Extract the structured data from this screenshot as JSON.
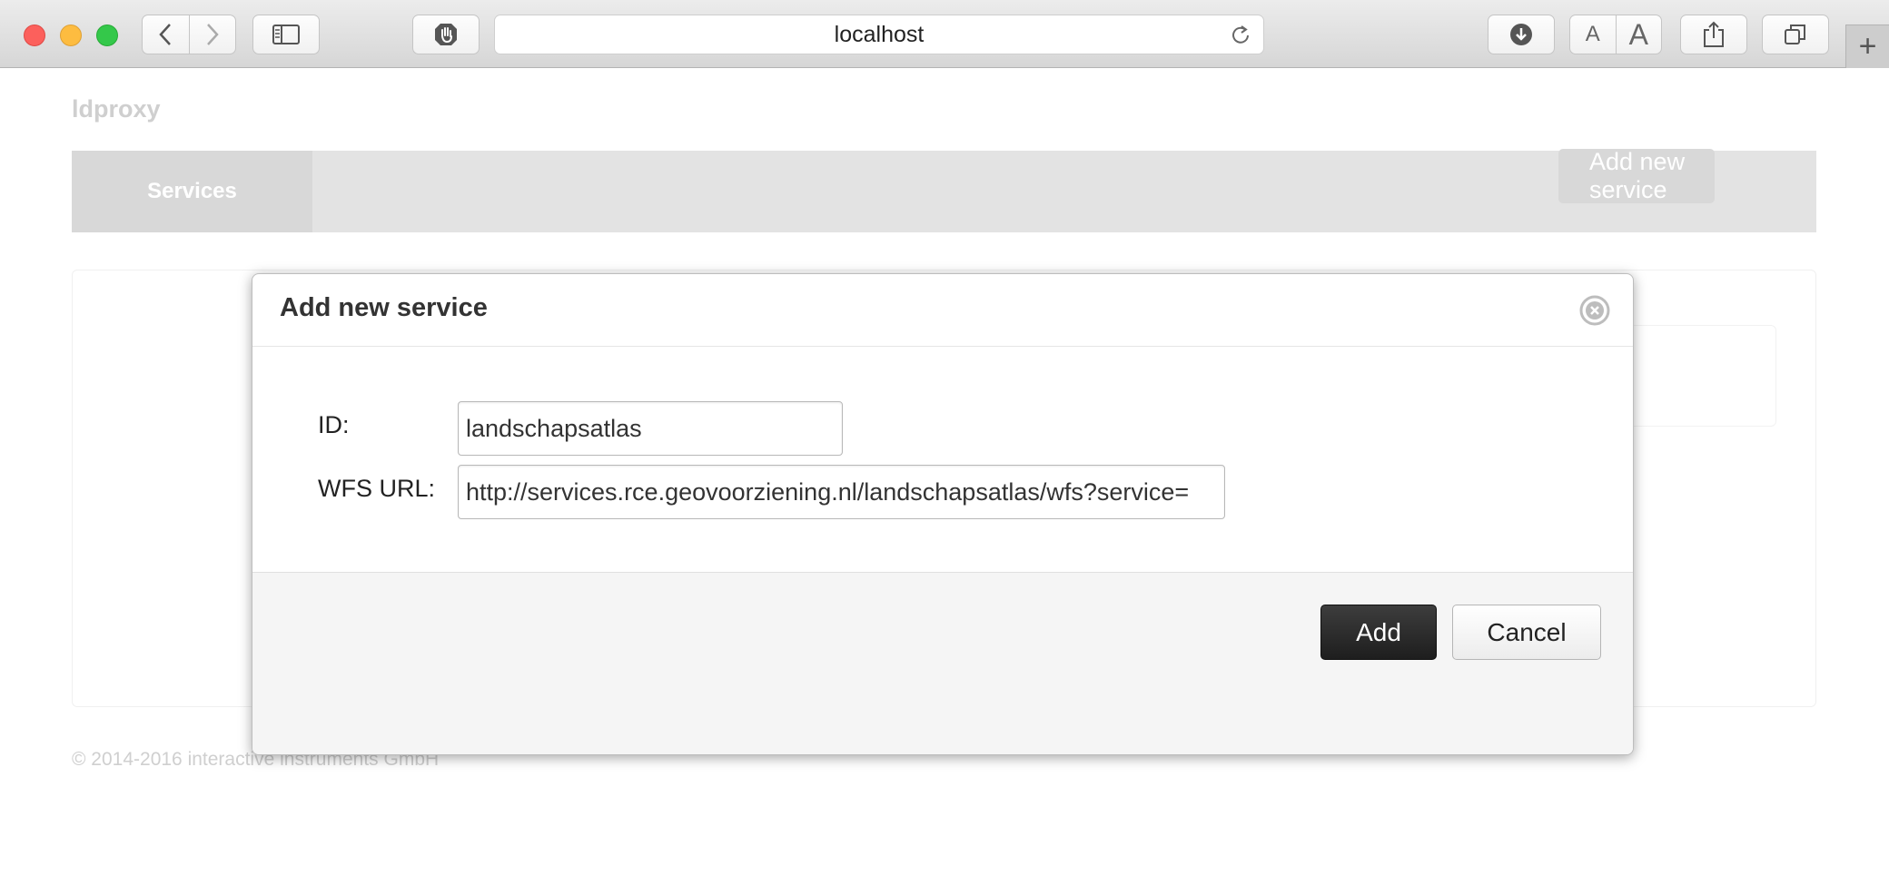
{
  "browser": {
    "address_text": "localhost",
    "new_tab_label": "+",
    "font_small_label": "A",
    "font_large_label": "A"
  },
  "page": {
    "brand": "ldproxy",
    "nav": {
      "services_label": "Services"
    },
    "background_button_label": "Add new service",
    "footer": "© 2014-2016 interactive instruments GmbH"
  },
  "modal": {
    "title": "Add new service",
    "id_label": "ID:",
    "id_value": "landschapsatlas",
    "wfs_url_label": "WFS URL:",
    "wfs_url_value": "http://services.rce.geovoorziening.nl/landschapsatlas/wfs?service=",
    "add_label": "Add",
    "cancel_label": "Cancel"
  },
  "colors": {
    "navbar_bg": "#e3e3e3",
    "nav_active_bg": "#d8d8d8",
    "primary_button": "#222222"
  }
}
